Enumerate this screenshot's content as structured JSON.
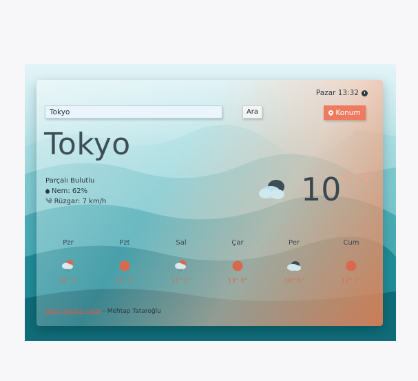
{
  "header": {
    "datetime": "Pazar 13:32"
  },
  "search": {
    "value": "Tokyo",
    "button_label": "Ara"
  },
  "location_button": {
    "label": "Konum"
  },
  "current": {
    "city": "Tokyo",
    "description": "Parçalı Bulutlu",
    "humidity": "Nem: 62%",
    "wind": "Rüzgar: 7 km/h",
    "temperature": "10",
    "units": "°C | °F",
    "icon": "cloud-icon"
  },
  "forecast": [
    {
      "day": "Pzr",
      "icon": "snow-sun-icon",
      "hi": "14°",
      "lo": "9°"
    },
    {
      "day": "Pzt",
      "icon": "sun-icon",
      "hi": "11°",
      "lo": "7°"
    },
    {
      "day": "Sal",
      "icon": "snow-sun-icon",
      "hi": "11°",
      "lo": "6°"
    },
    {
      "day": "Çar",
      "icon": "sun-icon",
      "hi": "13°",
      "lo": "8°"
    },
    {
      "day": "Per",
      "icon": "cloud-icon",
      "hi": "10°",
      "lo": "6°"
    },
    {
      "day": "Cum",
      "icon": "sun-icon",
      "hi": "12°",
      "lo": "7°"
    }
  ],
  "footer": {
    "link_text": "Open-source code",
    "credit": " - Mehtap Tataroğlu"
  },
  "colors": {
    "accent": "#ee7a5f",
    "text": "#3a4650",
    "sun": "#d9694d"
  }
}
